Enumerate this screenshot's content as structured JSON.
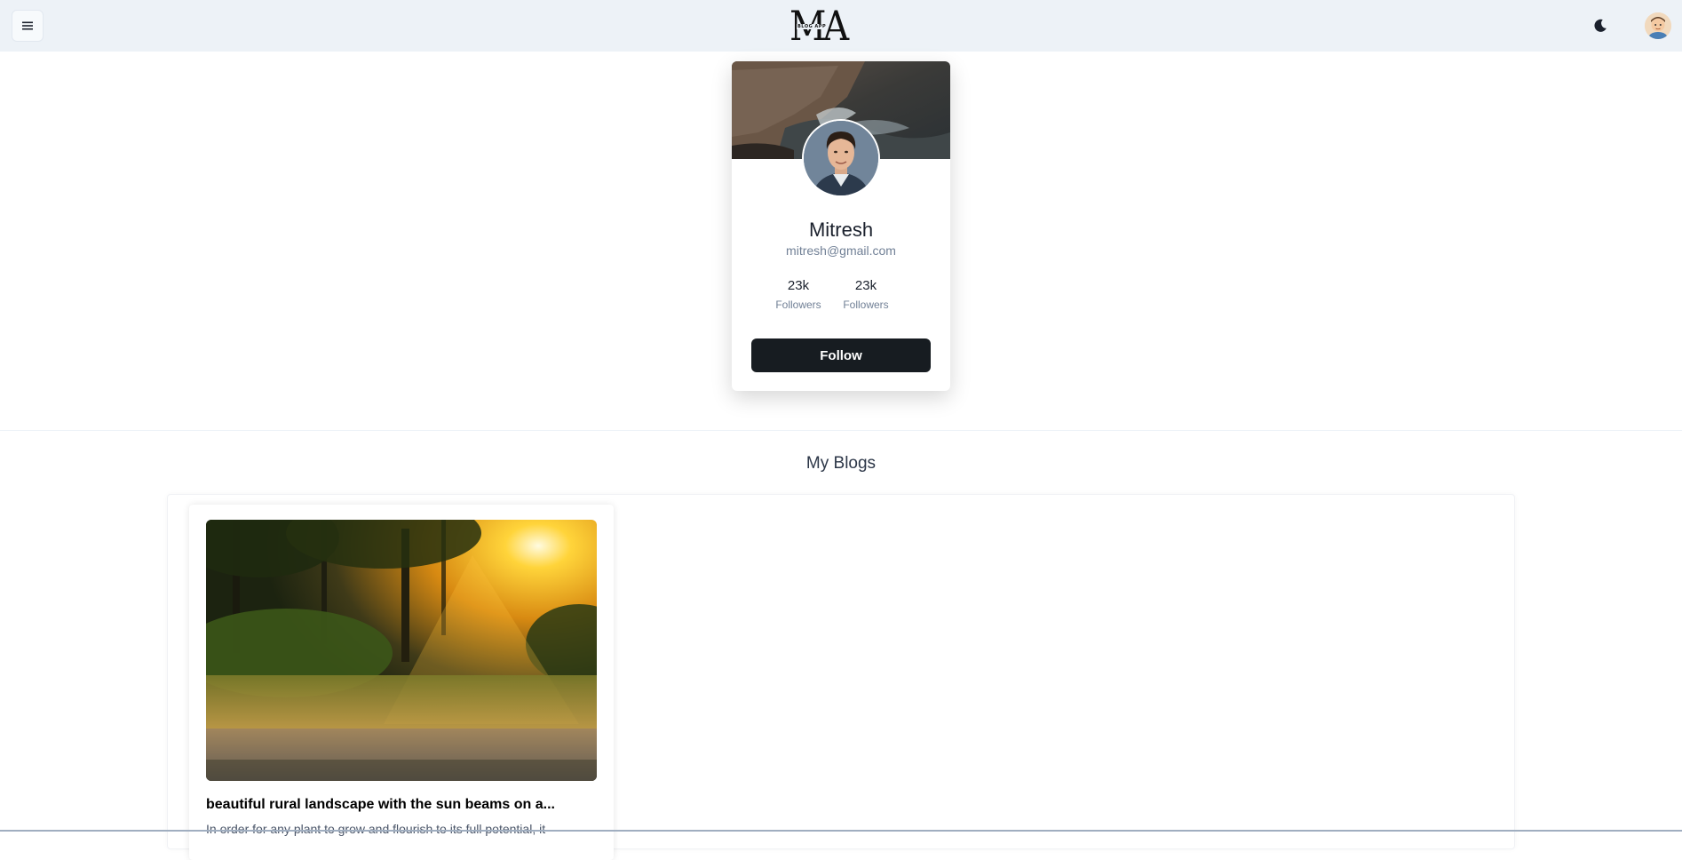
{
  "navbar": {
    "logo_main": "MA",
    "logo_sub": "BLOG APP",
    "icons": {
      "menu": "hamburger-menu-icon",
      "theme": "moon-icon"
    }
  },
  "profile": {
    "name": "Mitresh",
    "email": "mitresh@gmail.com",
    "stats": [
      {
        "value": "23k",
        "label": "Followers"
      },
      {
        "value": "23k",
        "label": "Followers"
      }
    ],
    "follow_label": "Follow"
  },
  "blogs": {
    "section_title": "My Blogs",
    "items": [
      {
        "title": "beautiful rural landscape with the sun beams on a...",
        "excerpt": "In order for any plant to grow and flourish to its full potential, it"
      }
    ]
  },
  "colors": {
    "navbar_bg": "#edf2f7",
    "button_dark": "#171c21",
    "muted_text": "#718096"
  }
}
